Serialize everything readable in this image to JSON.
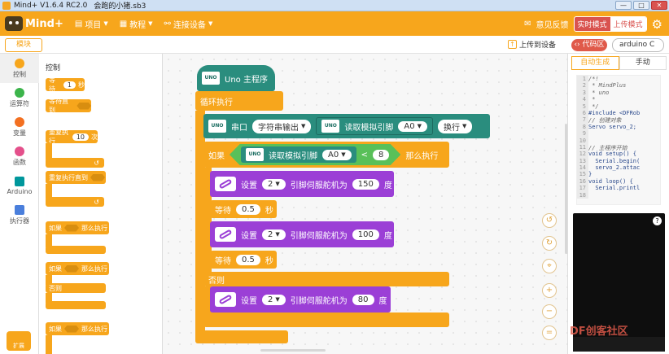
{
  "window": {
    "title": "Mind+ V1.6.4 RC2.0",
    "filename": "会跑的小猪.sb3",
    "buttons": [
      "—",
      "□",
      "✕"
    ]
  },
  "menubar": {
    "logo": "Mind+",
    "items": [
      "项目",
      "教程",
      "连接设备"
    ],
    "feedback": "意见反馈",
    "mode_live": "实时模式",
    "mode_upload": "上传模式"
  },
  "toolbar": {
    "tab": "模块",
    "upload": "上传到设备",
    "code_area": "代码区",
    "board": "arduino C"
  },
  "categories": [
    {
      "label": "控制",
      "color": "#f7a61c"
    },
    {
      "label": "运算符",
      "color": "#3cb44b"
    },
    {
      "label": "变量",
      "color": "#f37021"
    },
    {
      "label": "函数",
      "color": "#e4508b"
    },
    {
      "label": "Arduino",
      "color": "#00979c"
    },
    {
      "label": "执行器",
      "color": "#4a7fdc"
    }
  ],
  "extension": "扩展",
  "palette": {
    "title": "控制",
    "wait_label": "等待",
    "wait_value": "1",
    "wait_unit": "秒",
    "wait_until": "等待直到",
    "repeat_label": "重复执行",
    "repeat_value": "10",
    "repeat_unit": "次",
    "repeat_until": "重复执行直到",
    "if_label": "如果",
    "then_label": "那么执行",
    "else_label": "否则"
  },
  "program": {
    "hat": "Uno 主程序",
    "loop": "循环执行",
    "serial": {
      "label": "串口",
      "mode": "字符串输出",
      "read": "读取模拟引脚",
      "pin": "A0",
      "newline": "换行"
    },
    "if": {
      "label": "如果",
      "read": "读取模拟引脚",
      "pin": "A0",
      "op": "<",
      "value": "8",
      "then": "那么执行"
    },
    "servo1": {
      "set": "设置",
      "pin": "2",
      "text": "引脚伺服舵机为",
      "value": "150",
      "unit": "度"
    },
    "wait1": {
      "label": "等待",
      "value": "0.5",
      "unit": "秒"
    },
    "servo2": {
      "set": "设置",
      "pin": "2",
      "text": "引脚伺服舵机为",
      "value": "100",
      "unit": "度"
    },
    "wait2": {
      "label": "等待",
      "value": "0.5",
      "unit": "秒"
    },
    "else": "否则",
    "servo3": {
      "set": "设置",
      "pin": "2",
      "text": "引脚伺服舵机为",
      "value": "80",
      "unit": "度"
    },
    "chip": "UNO"
  },
  "right_panel": {
    "tab_auto": "自动生成",
    "tab_manual": "手动",
    "code_lines": [
      {
        "n": "1",
        "t": "/*!",
        "c": true
      },
      {
        "n": "2",
        "t": " * MindPlus",
        "c": true
      },
      {
        "n": "3",
        "t": " * uno",
        "c": true
      },
      {
        "n": "4",
        "t": " *",
        "c": true
      },
      {
        "n": "5",
        "t": " */",
        "c": true
      },
      {
        "n": "6",
        "t": "#include <DFRob",
        "c": false
      },
      {
        "n": "7",
        "t": "// 创建对象",
        "c": true
      },
      {
        "n": "8",
        "t": "Servo servo_2;",
        "c": false
      },
      {
        "n": "9",
        "t": "",
        "c": false
      },
      {
        "n": "10",
        "t": "",
        "c": false
      },
      {
        "n": "11",
        "t": "// 主程序开始",
        "c": true
      },
      {
        "n": "12",
        "t": "void setup() {",
        "c": false
      },
      {
        "n": "13",
        "t": "  Serial.begin(",
        "c": false
      },
      {
        "n": "14",
        "t": "  servo_2.attac",
        "c": false
      },
      {
        "n": "15",
        "t": "}",
        "c": false
      },
      {
        "n": "16",
        "t": "void loop() {",
        "c": false
      },
      {
        "n": "17",
        "t": "  Serial.printl",
        "c": false
      },
      {
        "n": "18",
        "t": "",
        "c": false
      }
    ],
    "help": "?"
  },
  "workspace_controls": [
    "↺",
    "↻",
    "⌖",
    "+",
    "−",
    "="
  ],
  "watermark": "DF创客社区"
}
